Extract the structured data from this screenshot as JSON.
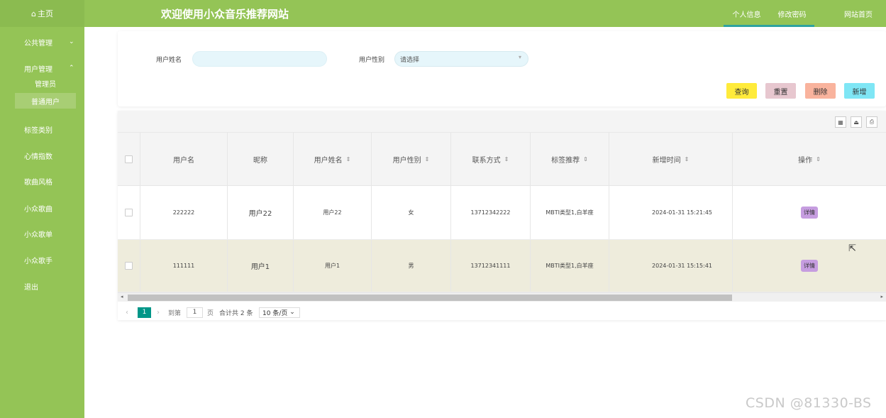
{
  "header": {
    "home_label": "主页",
    "title": "欢迎使用小众音乐推荐网站",
    "nav": [
      {
        "label": "个人信息",
        "active": true
      },
      {
        "label": "修改密码",
        "active": false
      },
      {
        "label": "网站首页",
        "active": false
      }
    ]
  },
  "sidebar": {
    "items": [
      {
        "label": "公共管理",
        "chevron": "chevron-down-icon"
      },
      {
        "label": "用户管理",
        "chevron": "chevron-up-icon"
      },
      {
        "label": "标签类别"
      },
      {
        "label": "心情指数"
      },
      {
        "label": "歌曲风格"
      },
      {
        "label": "小众歌曲"
      },
      {
        "label": "小众歌单"
      },
      {
        "label": "小众歌手"
      },
      {
        "label": "退出"
      }
    ],
    "sub_items": [
      {
        "label": "管理员",
        "active": false
      },
      {
        "label": "普通用户",
        "active": true
      }
    ]
  },
  "search": {
    "name_label": "用户姓名",
    "name_value": "",
    "gender_label": "用户性别",
    "gender_value": "请选择",
    "buttons": {
      "query": "查询",
      "reset": "重置",
      "delete": "删除",
      "add": "新增"
    }
  },
  "table": {
    "columns": [
      "用户名",
      "昵称",
      "用户姓名",
      "用户性别",
      "联系方式",
      "标签推荐",
      "新增时间",
      "操作"
    ],
    "rows": [
      {
        "username": "222222",
        "nickname": "用户22",
        "name": "用户22",
        "gender": "女",
        "phone": "13712342222",
        "tags": "MBTI类型1,白羊座",
        "time": "2024-01-31 15:21:45",
        "action": "详情"
      },
      {
        "username": "111111",
        "nickname": "用户1",
        "name": "用户1",
        "gender": "男",
        "phone": "13712341111",
        "tags": "MBTI类型1,白羊座",
        "time": "2024-01-31 15:15:41",
        "action": "详情"
      }
    ]
  },
  "pagination": {
    "current_page": "1",
    "goto_label": "到第",
    "goto_value": "1",
    "page_unit": "页",
    "total_text": "合计共 2 条",
    "page_size": "10 条/页"
  },
  "watermark": "CSDN @81330-BS",
  "colors": {
    "theme_green": "#94c456",
    "query_btn": "#ffeb3b",
    "reset_btn": "#e7c7cf",
    "delete_btn": "#f9b39d",
    "add_btn": "#7fe6f5",
    "detail_btn": "#c69de0",
    "page_active": "#009688"
  }
}
